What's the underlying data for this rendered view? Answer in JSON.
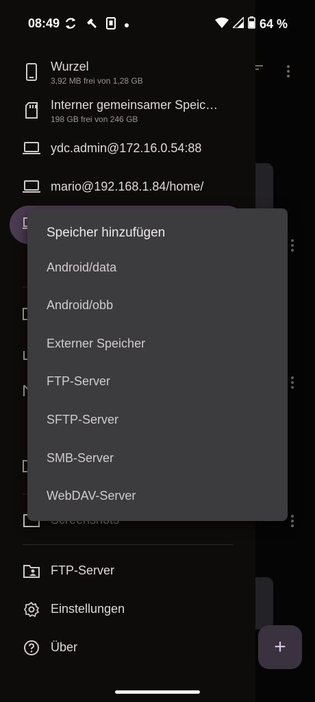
{
  "status_bar": {
    "time": "08:49",
    "battery": "64 %"
  },
  "drawer": {
    "storages": [
      {
        "title": "Wurzel",
        "subtitle": "3,92 MB frei von 1,28 GB",
        "icon": "phone-icon"
      },
      {
        "title": "Interner gemeinsamer Speic…",
        "subtitle": "198 GB frei von 246 GB",
        "icon": "sd-card-icon"
      },
      {
        "title": "ydc.admin@172.16.0.54:88",
        "subtitle": "",
        "icon": "laptop-icon"
      },
      {
        "title": "mario@192.168.1.84/home/",
        "subtitle": "",
        "icon": "laptop-icon"
      }
    ],
    "partial_item": "Screenshots",
    "bottom_items": [
      {
        "title": "FTP-Server",
        "icon": "folder-share-icon"
      },
      {
        "title": "Einstellungen",
        "icon": "gear-icon"
      },
      {
        "title": "Über",
        "icon": "help-icon"
      }
    ]
  },
  "popup": {
    "title": "Speicher hinzufügen",
    "items": [
      "Android/data",
      "Android/obb",
      "Externer Speicher",
      "FTP-Server",
      "SFTP-Server",
      "SMB-Server",
      "WebDAV-Server"
    ]
  },
  "fab": {
    "label": "+"
  },
  "colors": {
    "drawer_bg": "#0e0c0a",
    "selected_pill": "#4b3b52",
    "popup_bg": "#3c3c3e",
    "fab_bg": "#3b3240"
  }
}
